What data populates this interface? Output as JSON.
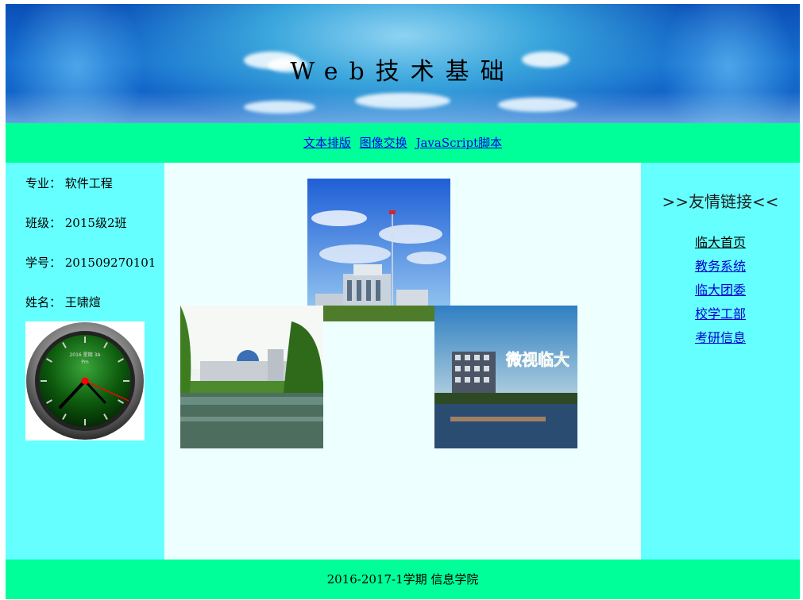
{
  "header": {
    "title": "Web技术基础"
  },
  "nav": {
    "items": [
      {
        "label": "文本排版"
      },
      {
        "label": "图像交换"
      },
      {
        "label": "JavaScript脚本"
      }
    ]
  },
  "left": {
    "major": "专业：  软件工程",
    "class": "班级：  2015级2班",
    "student_id": "学号：  201509270101",
    "name": "姓名：  王啸煊"
  },
  "clock": {
    "date_text": "2016 星期 3A",
    "sub_text": "Pm"
  },
  "right": {
    "title": ">>友情链接<<",
    "links": [
      {
        "label": "临大首页"
      },
      {
        "label": "教务系统"
      },
      {
        "label": "临大团委"
      },
      {
        "label": "校学工部"
      },
      {
        "label": "考研信息"
      }
    ]
  },
  "photos": {
    "lake_building_sign": "微视临大"
  },
  "footer": {
    "text": "2016-2017-1学期 信息学院"
  },
  "colors": {
    "nav_bg": "#00ff99",
    "side_bg": "#66ffff",
    "content_bg": "#eeffff",
    "link": "#0000ee"
  }
}
